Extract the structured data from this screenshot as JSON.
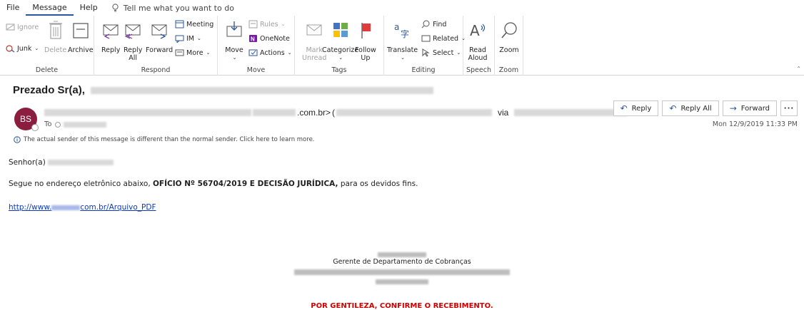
{
  "menubar": {
    "items": [
      "File",
      "Message",
      "Help"
    ],
    "active": "Message",
    "tell_me": "Tell me what you want to do"
  },
  "ribbon": {
    "delete": {
      "label": "Delete",
      "ignore": "Ignore",
      "junk": "Junk",
      "delete_btn": "Delete",
      "archive": "Archive"
    },
    "respond": {
      "label": "Respond",
      "reply": "Reply",
      "reply_all_1": "Reply",
      "reply_all_2": "All",
      "forward": "Forward",
      "meeting": "Meeting",
      "im": "IM",
      "more": "More"
    },
    "move": {
      "label": "Move",
      "move_btn": "Move",
      "rules": "Rules",
      "onenote": "OneNote",
      "actions": "Actions"
    },
    "tags": {
      "label": "Tags",
      "mark_unread_1": "Mark",
      "mark_unread_2": "Unread",
      "categorize": "Categorize",
      "follow_up_1": "Follow",
      "follow_up_2": "Up"
    },
    "editing": {
      "label": "Editing",
      "translate": "Translate",
      "find": "Find",
      "related": "Related",
      "select": "Select"
    },
    "speech": {
      "label": "Speech",
      "read_aloud_1": "Read",
      "read_aloud_2": "Aloud"
    },
    "zoom": {
      "label": "Zoom",
      "zoom_btn": "Zoom"
    }
  },
  "email": {
    "subject": "Prezado Sr(a),",
    "avatar_initials": "BS",
    "sender_domain": ".com.br>",
    "sender_paren": "(",
    "sender_via": "via",
    "to_label": "To",
    "warning": "The actual sender of this message is different than the normal sender. Click here to learn more.",
    "actions": {
      "reply": "Reply",
      "reply_all": "Reply All",
      "forward": "Forward"
    },
    "date": "Mon 12/9/2019 11:33 PM",
    "greeting": "Senhor(a)",
    "body_pre": "Segue no endereço eletrônico abaixo, ",
    "body_bold": "OFÍCIO Nº 56704/2019 E DECISÃO JURÍDICA,",
    "body_post": " para os devidos fins.",
    "link_pre": "http://www.",
    "link_post": "com.br/Arquivo_PDF",
    "signature_title": "Gerente de Departamento de Cobranças",
    "confirm": "POR GENTILEZA, CONFIRME O RECEBIMENTO."
  },
  "colors": {
    "accent": "#2b579a",
    "avatar": "#8b1e3f",
    "link": "#0b39c4",
    "confirm_red": "#d40000"
  }
}
